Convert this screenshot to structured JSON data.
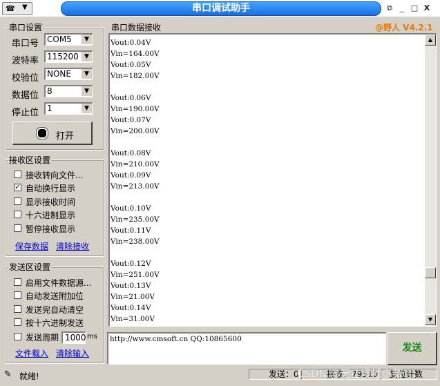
{
  "window": {
    "title": "串口调试助手",
    "version": "@野人 V4.2.1",
    "controls": [
      "⧉",
      "_",
      "□",
      "X"
    ]
  },
  "serial_settings": {
    "legend": "串口设置",
    "fields": [
      {
        "label": "串口号",
        "value": "COM5"
      },
      {
        "label": "波特率",
        "value": "115200"
      },
      {
        "label": "校验位",
        "value": "NONE"
      },
      {
        "label": "数据位",
        "value": "8"
      },
      {
        "label": "停止位",
        "value": "1"
      }
    ],
    "open_button": "打开"
  },
  "receive_settings": {
    "legend": "接收区设置",
    "options": [
      {
        "label": "接收转向文件...",
        "checked": false
      },
      {
        "label": "自动换行显示",
        "checked": true
      },
      {
        "label": "显示接收时间",
        "checked": false
      },
      {
        "label": "十六进制显示",
        "checked": false
      },
      {
        "label": "暂停接收显示",
        "checked": false
      }
    ],
    "save_link": "保存数据",
    "clear_link": "清除接收"
  },
  "send_settings": {
    "legend": "发送区设置",
    "options": [
      {
        "label": "启用文件数据源...",
        "checked": false
      },
      {
        "label": "自动发送附加位",
        "checked": false
      },
      {
        "label": "发送完自动清空",
        "checked": false
      },
      {
        "label": "按十六进制发送",
        "checked": false
      },
      {
        "label": "发送周期",
        "checked": false
      }
    ],
    "period_value": "1000",
    "period_unit": "ms",
    "load_link": "文件载入",
    "clear_link": "清除输入"
  },
  "receive_area": {
    "title": "串口数据接收",
    "lines": [
      "Vout:0.04V",
      "Vin=164.00V",
      "Vout:0.05V",
      "Vin=182.00V",
      "",
      "Vout:0.06V",
      "Vin=190.00V",
      "Vout:0.07V",
      "Vin=200.00V",
      "",
      "Vout:0.08V",
      "Vin=210.00V",
      "Vout:0.09V",
      "Vin=213.00V",
      "",
      "Vout:0.10V",
      "Vin=235.00V",
      "Vout:0.11V",
      "Vin=238.00V",
      "",
      "Vout:0.12V",
      "Vin=251.00V",
      "Vout:0.13V",
      "Vin=21.00V",
      "Vout:0.14V",
      "Vin=31.00V"
    ]
  },
  "send_area": {
    "text": "http://www.cmsoft.cn QQ:10865600",
    "send_button": "发送"
  },
  "status_bar": {
    "ready": "就绪!",
    "send_count": "发送：0",
    "recv_count": "接收：79310",
    "reset": "复位计数",
    "watermark": "CSDN @无止境地小薇"
  }
}
